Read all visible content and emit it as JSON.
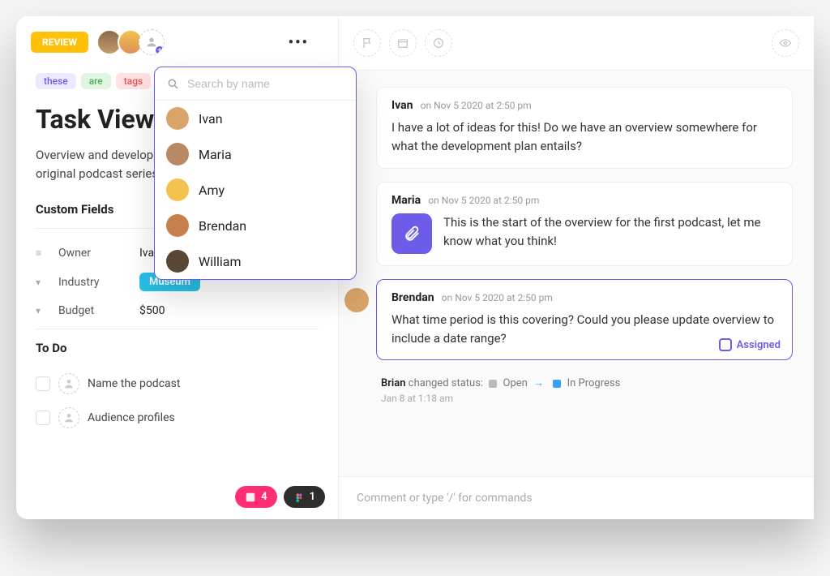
{
  "header": {
    "review_label": "REVIEW"
  },
  "tags": [
    "these",
    "are",
    "tags"
  ],
  "title": "Task View",
  "description": "Overview and development plans for our new line of original podcast series.",
  "custom_fields": {
    "label": "Custom Fields",
    "rows": [
      {
        "label": "Owner",
        "value": "Ivan"
      },
      {
        "label": "Industry",
        "value": "Museum",
        "pill": true
      },
      {
        "label": "Budget",
        "value": "$500"
      }
    ]
  },
  "todo": {
    "label": "To Do",
    "items": [
      "Name the podcast",
      "Audience profiles"
    ]
  },
  "dropdown": {
    "placeholder": "Search by name",
    "people": [
      "Ivan",
      "Maria",
      "Amy",
      "Brendan",
      "William"
    ]
  },
  "footer": {
    "count_a": "4",
    "count_b": "1"
  },
  "comments": [
    {
      "name": "Ivan",
      "time": "on Nov 5 2020 at 2:50 pm",
      "body": "I have a lot of ideas for this! Do we have an overview somewhere for what the development plan entails?"
    },
    {
      "name": "Maria",
      "time": "on Nov 5 2020 at 2:50 pm",
      "body": "This is the start of the overview for the first podcast, let me know what you think!",
      "attachment": true
    },
    {
      "name": "Brendan",
      "time": "on Nov 5 2020 at 2:50 pm",
      "body": "What time period is this covering? Could you please update overview to include a date range?",
      "highlight": true,
      "assigned_label": "Assigned"
    }
  ],
  "activity": {
    "who": "Brian",
    "verb": "changed status:",
    "from": "Open",
    "to": "In Progress",
    "timestamp": "Jan 8 at 1:18 am"
  },
  "composer_placeholder": "Comment or type '/' for commands"
}
